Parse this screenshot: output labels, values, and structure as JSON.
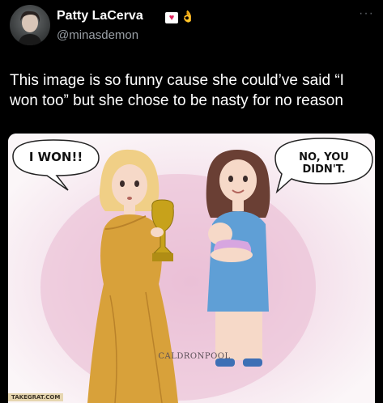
{
  "author": {
    "name": "Patty LaCerva",
    "handle": "@minasdemon",
    "badges": [
      "heart-icon",
      "hand-icon"
    ]
  },
  "more_label": "···",
  "tweet": {
    "text": "This image is so funny cause she could’ve said “I won too” but she chose to be nasty for no reason"
  },
  "media": {
    "bubble_left": "I WON!!",
    "bubble_right": "NO, YOU DIDN'T.",
    "logo_text": "CALDRONPOOL",
    "watermark": "TAKEGRAT.COM"
  },
  "colors": {
    "background": "#000000",
    "handle": "#9aa0a6",
    "gown": "#d8a13a",
    "dress": "#5f9fd6",
    "trophy": "#c7a21b"
  }
}
